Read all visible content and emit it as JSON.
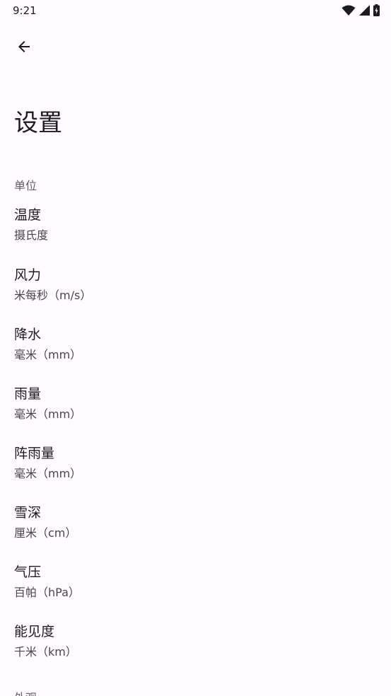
{
  "status_bar": {
    "time": "9:21",
    "icons": [
      "wifi-icon",
      "cell-signal-icon",
      "battery-charging-icon"
    ]
  },
  "toolbar": {
    "back_icon": "arrow-back-icon"
  },
  "page": {
    "title": "设置"
  },
  "sections": {
    "units": {
      "header": "单位",
      "items": [
        {
          "title": "温度",
          "value": "摄氏度"
        },
        {
          "title": "风力",
          "value": "米每秒（m/s）"
        },
        {
          "title": "降水",
          "value": "毫米（mm）"
        },
        {
          "title": "雨量",
          "value": "毫米（mm）"
        },
        {
          "title": "阵雨量",
          "value": "毫米（mm）"
        },
        {
          "title": "雪深",
          "value": "厘米（cm）"
        },
        {
          "title": "气压",
          "value": "百帕（hPa）"
        },
        {
          "title": "能见度",
          "value": "千米（km）"
        }
      ]
    },
    "appearance": {
      "header": "外观"
    }
  }
}
